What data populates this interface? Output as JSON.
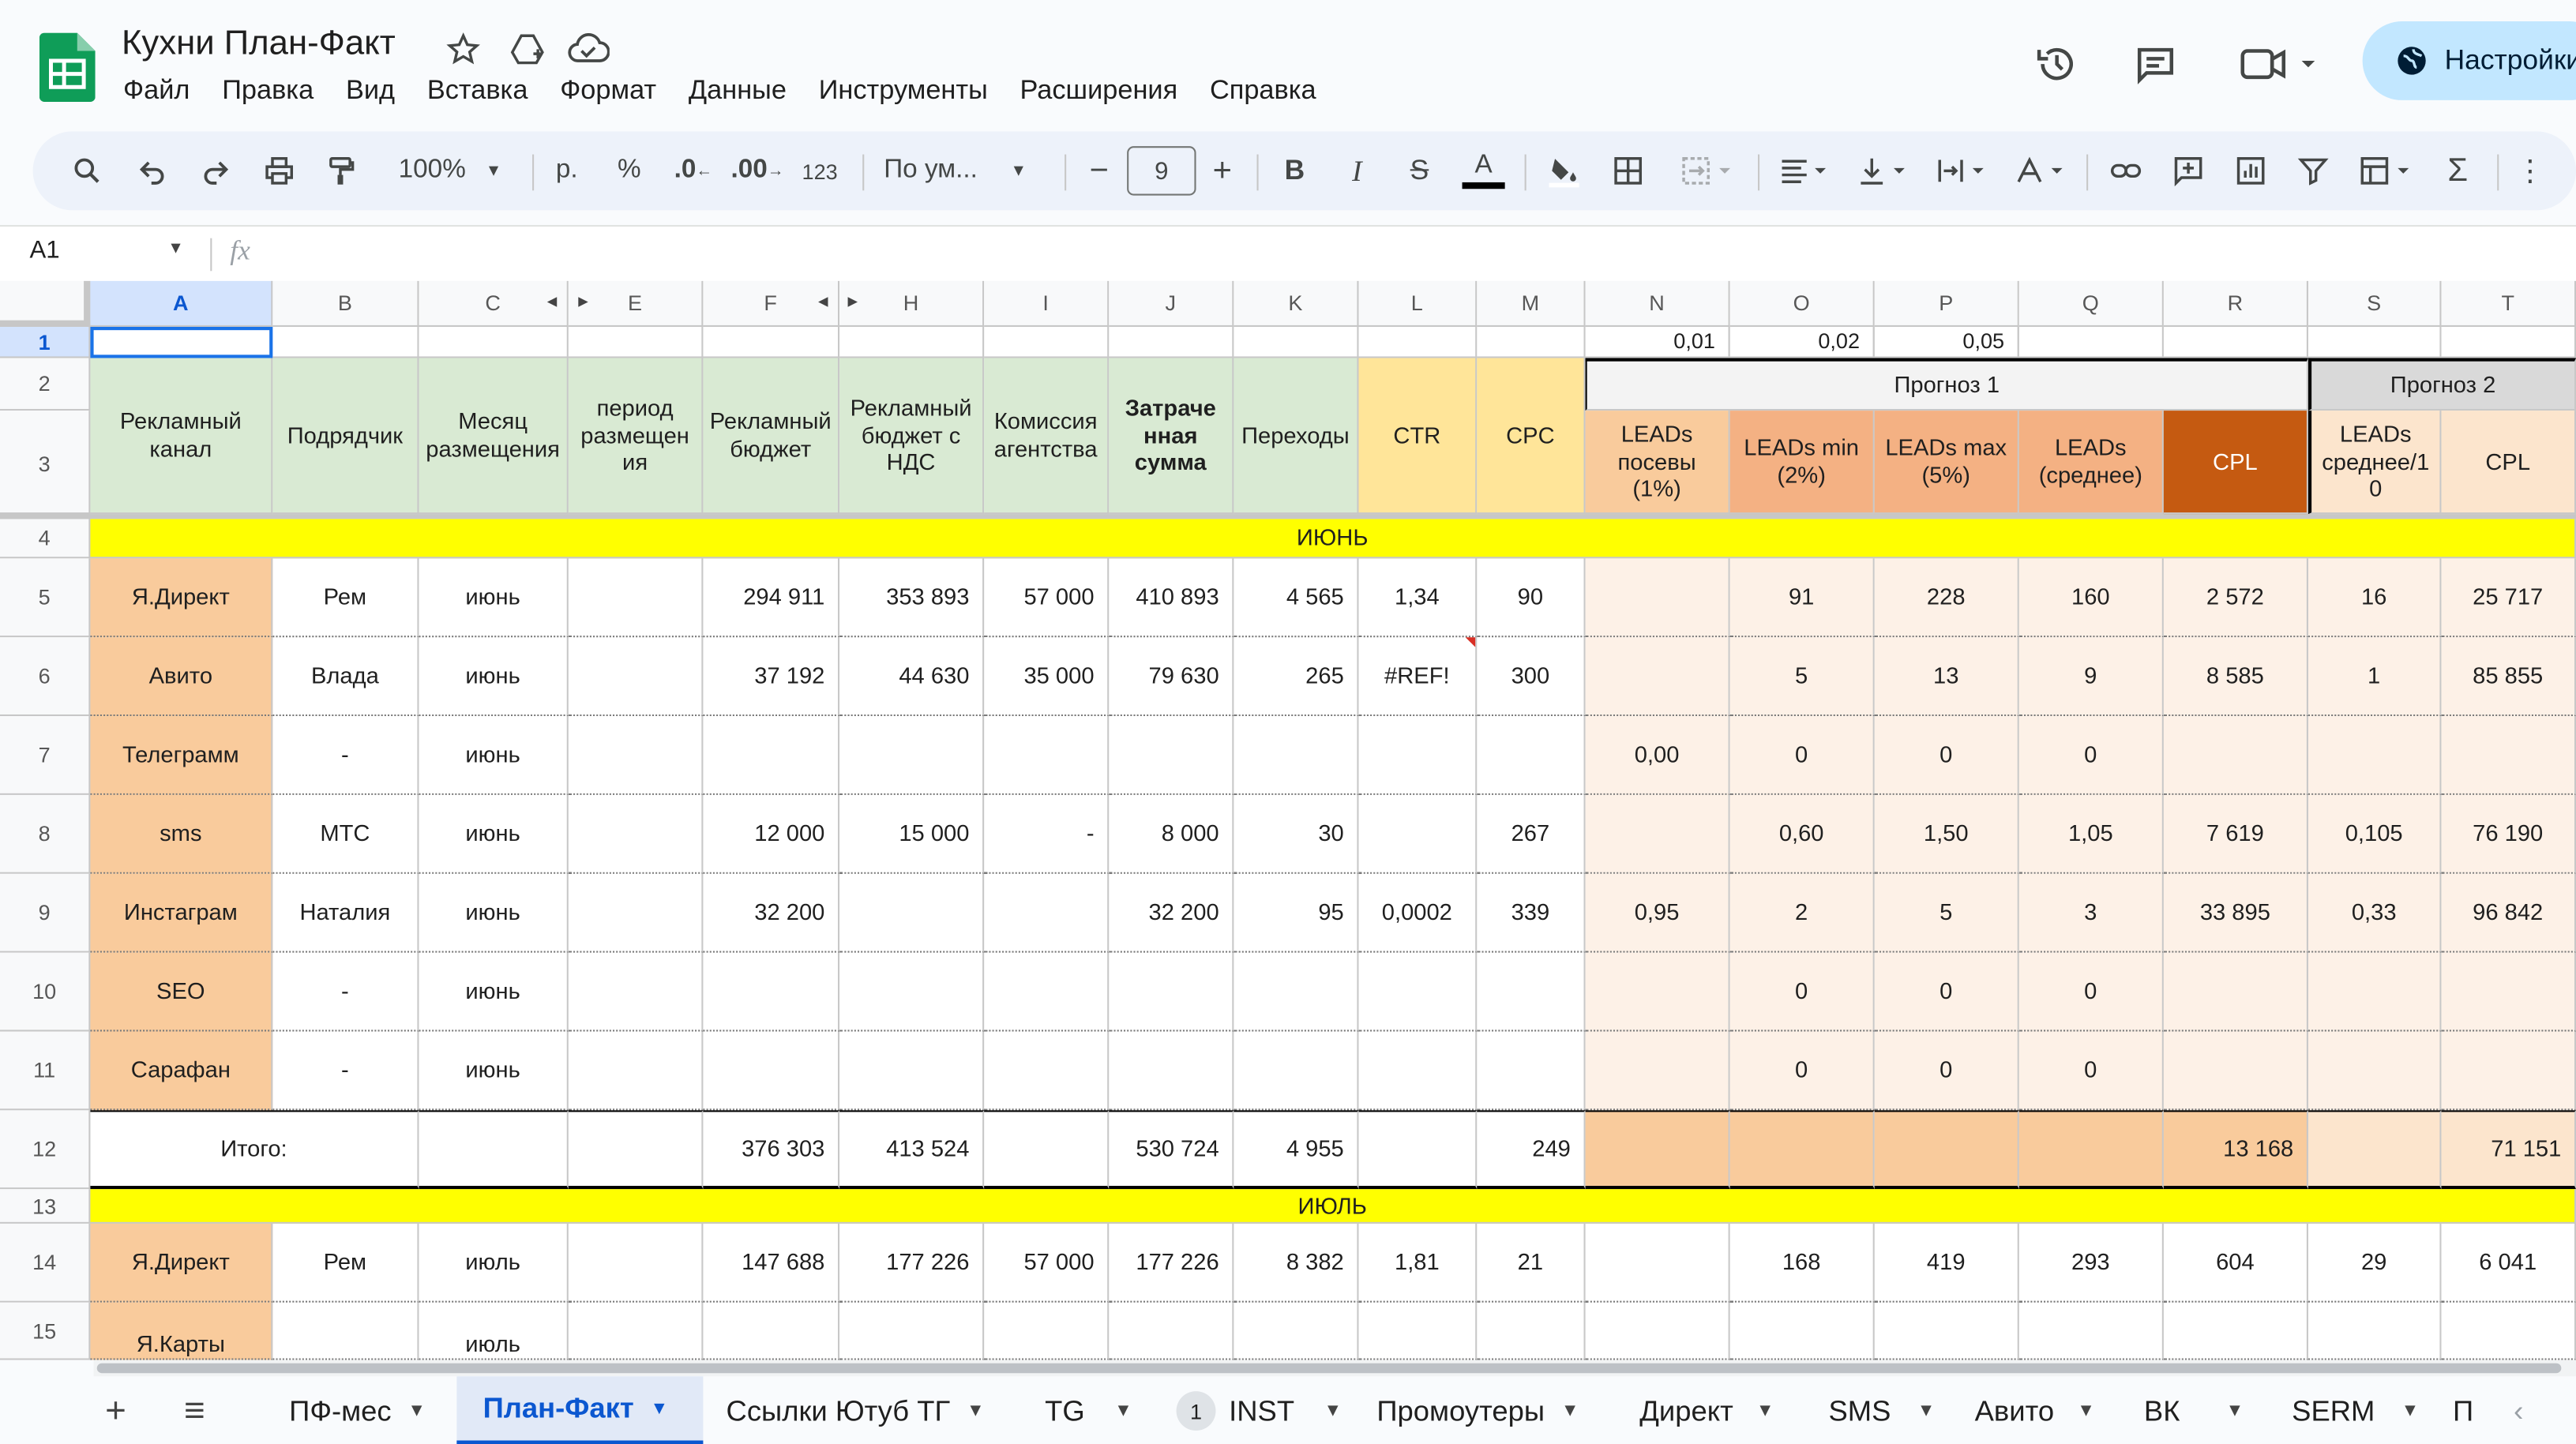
{
  "doc": {
    "title": "Кухни План-Факт"
  },
  "menu": [
    "Файл",
    "Правка",
    "Вид",
    "Вставка",
    "Формат",
    "Данные",
    "Инструменты",
    "Расширения",
    "Справка"
  ],
  "share_label": "Настройки",
  "toolbar": {
    "zoom": "100%",
    "currency": "р.",
    "percent": "%",
    "dec_less": ".0",
    "dec_more": ".00",
    "format_num": "123",
    "font": "По ум...",
    "font_size": "9"
  },
  "formula": {
    "cell_ref": "A1",
    "fx": "fx",
    "value": ""
  },
  "columns": [
    "A",
    "B",
    "C",
    "E",
    "F",
    "H",
    "I",
    "J",
    "K",
    "L",
    "M",
    "N",
    "O",
    "P",
    "Q",
    "R",
    "S",
    "T"
  ],
  "row_numbers": [
    "1",
    "2",
    "3",
    "4",
    "5",
    "6",
    "7",
    "8",
    "9",
    "10",
    "11",
    "12",
    "13",
    "14",
    "15"
  ],
  "row1": {
    "n": "0,01",
    "o": "0,02",
    "p": "0,05"
  },
  "headers": {
    "a": "Рекламный\nканал",
    "b": "Подрядчик",
    "c": "Месяц\nразмещения",
    "e": "период\nразмещен\nия",
    "f": "Рекламный\nбюджет",
    "h": "Рекламный\nбюджет с\nНДС",
    "i": "Комиссия\nагентства",
    "j": "Затраче\nнная\nсумма",
    "k": "Переходы",
    "l": "CTR",
    "m": "CPC",
    "prognoz1": "Прогноз 1",
    "prognoz2": "Прогноз 2",
    "n": "LEADs\nпосевы\n(1%)",
    "o": "LEADs min\n(2%)",
    "p": "LEADs max\n(5%)",
    "q": "LEADs\n(среднее)",
    "r": "CPL",
    "s": "LEADs\nсреднее/1\n0",
    "t": "CPL"
  },
  "months": {
    "june": "ИЮНЬ",
    "july": "ИЮЛЬ"
  },
  "rows": [
    {
      "a": "Я.Директ",
      "b": "Рем",
      "c": "июнь",
      "e": "",
      "f": "294 911",
      "h": "353 893",
      "i": "57 000",
      "j": "410 893",
      "k": "4 565",
      "l": "1,34",
      "m": "90",
      "n": "",
      "o": "91",
      "p": "228",
      "q": "160",
      "r": "2 572",
      "s": "16",
      "t": "25 717"
    },
    {
      "a": "Авито",
      "b": "Влада",
      "c": "июнь",
      "e": "",
      "f": "37 192",
      "h": "44 630",
      "i": "35 000",
      "j": "79 630",
      "k": "265",
      "l": "#REF!",
      "m": "300",
      "n": "",
      "o": "5",
      "p": "13",
      "q": "9",
      "r": "8 585",
      "s": "1",
      "t": "85 855"
    },
    {
      "a": "Телеграмм",
      "b": "-",
      "c": "июнь",
      "e": "",
      "f": "",
      "h": "",
      "i": "",
      "j": "",
      "k": "",
      "l": "",
      "m": "",
      "n": "0,00",
      "o": "0",
      "p": "0",
      "q": "0",
      "r": "",
      "s": "",
      "t": ""
    },
    {
      "a": "sms",
      "b": "МТС",
      "c": "июнь",
      "e": "",
      "f": "12 000",
      "h": "15 000",
      "i": "-",
      "j": "8 000",
      "k": "30",
      "l": "",
      "m": "267",
      "n": "",
      "o": "0,60",
      "p": "1,50",
      "q": "1,05",
      "r": "7 619",
      "s": "0,105",
      "t": "76 190"
    },
    {
      "a": "Инстаграм",
      "b": "Наталия",
      "c": "июнь",
      "e": "",
      "f": "32 200",
      "h": "",
      "i": "",
      "j": "32 200",
      "k": "95",
      "l": "0,0002",
      "m": "339",
      "n": "0,95",
      "o": "2",
      "p": "5",
      "q": "3",
      "r": "33 895",
      "s": "0,33",
      "t": "96 842"
    },
    {
      "a": "SEO",
      "b": "-",
      "c": "июнь",
      "e": "",
      "f": "",
      "h": "",
      "i": "",
      "j": "",
      "k": "",
      "l": "",
      "m": "",
      "n": "",
      "o": "0",
      "p": "0",
      "q": "0",
      "r": "",
      "s": "",
      "t": ""
    },
    {
      "a": "Сарафан",
      "b": "-",
      "c": "июнь",
      "e": "",
      "f": "",
      "h": "",
      "i": "",
      "j": "",
      "k": "",
      "l": "",
      "m": "",
      "n": "",
      "o": "0",
      "p": "0",
      "q": "0",
      "r": "",
      "s": "",
      "t": ""
    }
  ],
  "total": {
    "label": "Итого:",
    "f": "376 303",
    "h": "413 524",
    "j": "530 724",
    "k": "4 955",
    "m": "249",
    "r": "13 168",
    "t": "71 151"
  },
  "row14": {
    "a": "Я.Директ",
    "b": "Рем",
    "c": "июль",
    "f": "147 688",
    "h": "177 226",
    "i": "57 000",
    "j": "177 226",
    "k": "8 382",
    "l": "1,81",
    "m": "21",
    "o": "168",
    "p": "419",
    "q": "293",
    "r": "604",
    "s": "29",
    "t": "6 041"
  },
  "row15": {
    "a": "Я.Карты",
    "c": "июль"
  },
  "tabs": {
    "add": "+",
    "list": "≡",
    "items": [
      "ПФ-мес",
      "План-Факт",
      "Ссылки Ютуб ТГ",
      "TG",
      "INST",
      "Промоутеры",
      "Директ",
      "SMS",
      "Авито",
      "ВК",
      "SERM",
      "П"
    ],
    "inst_badge": "1"
  },
  "colors": {
    "green": "#d9ead3",
    "yellow": "#ffe599",
    "orange_light": "#f9cb9c",
    "orange": "#f4b183",
    "cpl_dark": "#c55a11",
    "peach": "#fce5cd",
    "month": "#ffff00",
    "accent": "#0b57d0"
  }
}
